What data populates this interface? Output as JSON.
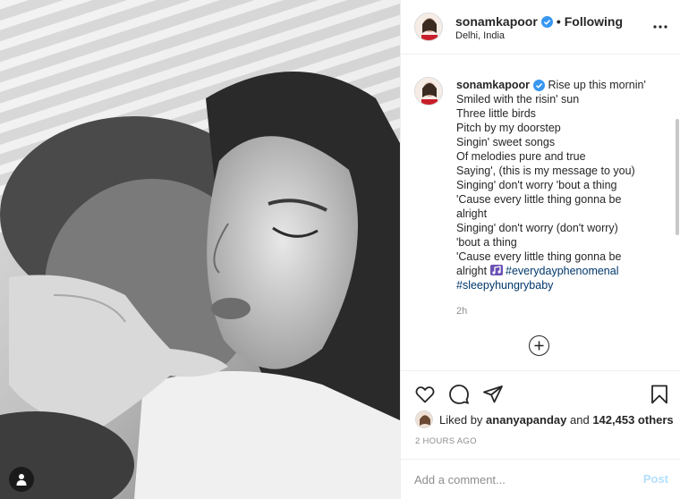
{
  "post": {
    "username": "sonamkapoor",
    "follow_status": "Following",
    "separator": "•",
    "location": "Delhi, India",
    "caption_lines": [
      "Rise up this mornin'",
      "Smiled with the risin' sun",
      "Three little birds",
      "Pitch by my doorstep",
      "Singin' sweet songs",
      "Of melodies pure and true",
      "Saying', (this is my message to you)",
      "Singing' don't worry 'bout a thing",
      "'Cause every little thing gonna be",
      "alright",
      "Singing' don't worry (don't worry)",
      "'bout a thing",
      "'Cause every little thing gonna be",
      "alright"
    ],
    "hashtags": [
      "#everydayphenomenal",
      "#sleepyhungrybaby"
    ],
    "caption_time": "2h",
    "likes": {
      "prefix": "Liked by",
      "user": "ananyapanday",
      "conjunction": "and",
      "count": "142,453 others"
    },
    "posted_ago": "2 HOURS AGO",
    "comment_placeholder": "Add a comment...",
    "post_label": "Post"
  },
  "icons": {
    "verified": "verified-badge-icon",
    "more": "more-options-icon",
    "like": "heart-icon",
    "comment": "comment-icon",
    "share": "share-icon",
    "save": "bookmark-icon",
    "load_more": "plus-circle-icon",
    "user_tag": "user-tag-icon"
  },
  "colors": {
    "verified_blue": "#3897f0",
    "hashtag": "#00376b",
    "muted": "#8e8e8e",
    "post_disabled": "#b2dffc"
  }
}
